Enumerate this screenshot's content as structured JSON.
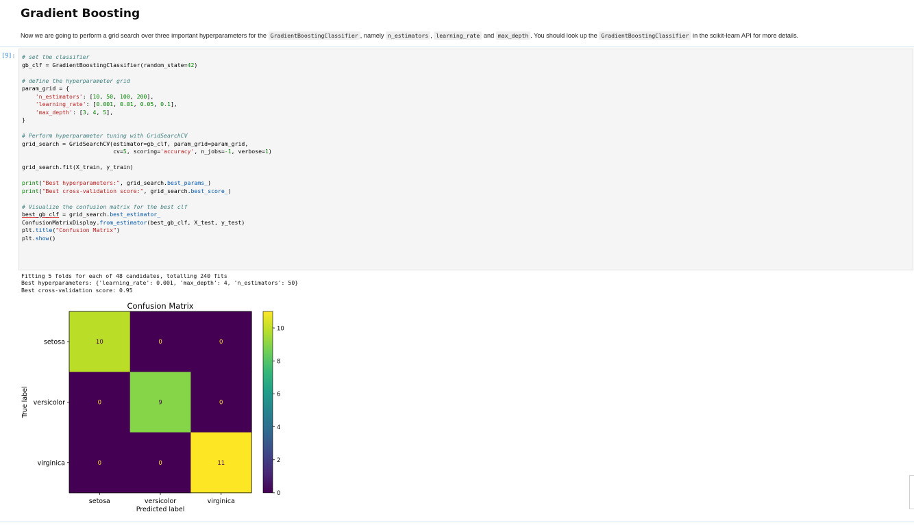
{
  "markdown": {
    "heading": "Gradient Boosting",
    "para_segments": [
      {
        "text": "Now we are going to perform a grid search over three important hyperparameters for the ",
        "code": false
      },
      {
        "text": "GradientBoostingClassifier",
        "code": true
      },
      {
        "text": ", namely ",
        "code": false
      },
      {
        "text": "n_estimators",
        "code": true
      },
      {
        "text": ", ",
        "code": false
      },
      {
        "text": "learning_rate",
        "code": true
      },
      {
        "text": " and ",
        "code": false
      },
      {
        "text": "max_depth",
        "code": true
      },
      {
        "text": ". You should look up the ",
        "code": false
      },
      {
        "text": "GradientBoostingClassifier",
        "code": true
      },
      {
        "text": " in the scikit-learn API for more details.",
        "code": false
      }
    ]
  },
  "cell": {
    "prompt": "[9]:",
    "code_lines": [
      [
        [
          "# set the classifier",
          "com"
        ]
      ],
      [
        [
          "gb_clf = GradientBoostingClassifier(random_state=",
          ""
        ],
        [
          "42",
          "num"
        ],
        [
          ")",
          ""
        ]
      ],
      [
        [
          "",
          ""
        ]
      ],
      [
        [
          "# define the hyperparameter grid",
          "com"
        ]
      ],
      [
        [
          "param_grid = {",
          ""
        ]
      ],
      [
        [
          "    ",
          ""
        ],
        [
          "'n_estimators'",
          "str"
        ],
        [
          ": [",
          ""
        ],
        [
          "10",
          "num"
        ],
        [
          ", ",
          ""
        ],
        [
          "50",
          "num"
        ],
        [
          ", ",
          ""
        ],
        [
          "100",
          "num"
        ],
        [
          ", ",
          ""
        ],
        [
          "200",
          "num"
        ],
        [
          "],",
          ""
        ]
      ],
      [
        [
          "    ",
          ""
        ],
        [
          "'learning_rate'",
          "str"
        ],
        [
          ": [",
          ""
        ],
        [
          "0.001",
          "num"
        ],
        [
          ", ",
          ""
        ],
        [
          "0.01",
          "num"
        ],
        [
          ", ",
          ""
        ],
        [
          "0.05",
          "num"
        ],
        [
          ", ",
          ""
        ],
        [
          "0.1",
          "num"
        ],
        [
          "],",
          ""
        ]
      ],
      [
        [
          "    ",
          ""
        ],
        [
          "'max_depth'",
          "str"
        ],
        [
          ": [",
          ""
        ],
        [
          "3",
          "num"
        ],
        [
          ", ",
          ""
        ],
        [
          "4",
          "num"
        ],
        [
          ", ",
          ""
        ],
        [
          "5",
          "num"
        ],
        [
          "],",
          ""
        ]
      ],
      [
        [
          "}",
          ""
        ]
      ],
      [
        [
          "",
          ""
        ]
      ],
      [
        [
          "# Perform hyperparameter tuning with GridSearchCV",
          "com"
        ]
      ],
      [
        [
          "grid_search = GridSearchCV(estimator=gb_clf, param_grid=param_grid,",
          ""
        ]
      ],
      [
        [
          "                           cv=",
          ""
        ],
        [
          "5",
          "num"
        ],
        [
          ", scoring=",
          ""
        ],
        [
          "'accuracy'",
          "str"
        ],
        [
          ", n_jobs=",
          ""
        ],
        [
          "-1",
          "num"
        ],
        [
          ", verbose=",
          ""
        ],
        [
          "1",
          "num"
        ],
        [
          ")",
          ""
        ]
      ],
      [
        [
          "",
          ""
        ]
      ],
      [
        [
          "grid_search.fit(X_train, y_train)",
          ""
        ]
      ],
      [
        [
          "",
          ""
        ]
      ],
      [
        [
          "print",
          "kw"
        ],
        [
          "(",
          ""
        ],
        [
          "\"Best hyperparameters:\"",
          "str"
        ],
        [
          ", grid_search.",
          ""
        ],
        [
          "best_params_",
          "fn"
        ],
        [
          ")",
          ""
        ]
      ],
      [
        [
          "print",
          "kw"
        ],
        [
          "(",
          ""
        ],
        [
          "\"Best cross-validation score:\"",
          "str"
        ],
        [
          ", grid_search.",
          ""
        ],
        [
          "best_score_",
          "fn"
        ],
        [
          ")",
          ""
        ]
      ],
      [
        [
          "",
          ""
        ]
      ],
      [
        [
          "# Visualize the confusion matrix for the best clf",
          "com"
        ]
      ],
      [
        [
          "best_gb_clf",
          "var"
        ],
        [
          " = grid_search.",
          ""
        ],
        [
          "best_estimator_",
          "fn"
        ]
      ],
      [
        [
          "ConfusionMatrixDisplay.",
          ""
        ],
        [
          "from_estimator",
          "fn"
        ],
        [
          "(best_gb_clf, X_test, y_test)",
          ""
        ]
      ],
      [
        [
          "plt.",
          ""
        ],
        [
          "title",
          "fn"
        ],
        [
          "(",
          ""
        ],
        [
          "\"Confusion Matrix\"",
          "str"
        ],
        [
          ")",
          ""
        ]
      ],
      [
        [
          "plt.",
          ""
        ],
        [
          "show",
          "fn"
        ],
        [
          "()",
          ""
        ]
      ]
    ],
    "output_lines": [
      "Fitting 5 folds for each of 48 candidates, totalling 240 fits",
      "Best hyperparameters: {'learning_rate': 0.001, 'max_depth': 4, 'n_estimators': 50}",
      "Best cross-validation score: 0.95"
    ]
  },
  "colors": {
    "code_bg": "#f5f5f5",
    "prompt": "#307fc1",
    "comment": "#408080",
    "string": "#ba2121",
    "number": "#008000"
  },
  "chart_data": {
    "type": "heatmap",
    "title": "Confusion Matrix",
    "xlabel": "Predicted label",
    "ylabel": "True label",
    "x_categories": [
      "setosa",
      "versicolor",
      "virginica"
    ],
    "y_categories": [
      "setosa",
      "versicolor",
      "virginica"
    ],
    "values": [
      [
        10,
        0,
        0
      ],
      [
        0,
        9,
        0
      ],
      [
        0,
        0,
        11
      ]
    ],
    "colormap": "viridis",
    "colorbar": {
      "min": 0,
      "max": 11,
      "ticks": [
        0,
        2,
        4,
        6,
        8,
        10
      ]
    },
    "cell_colors": {
      "10": "#bade28",
      "9": "#86d549",
      "11": "#fde725",
      "0": "#440154"
    },
    "text_colors": {
      "dark_cell": "#fde725",
      "light_cell": "#440154"
    }
  }
}
